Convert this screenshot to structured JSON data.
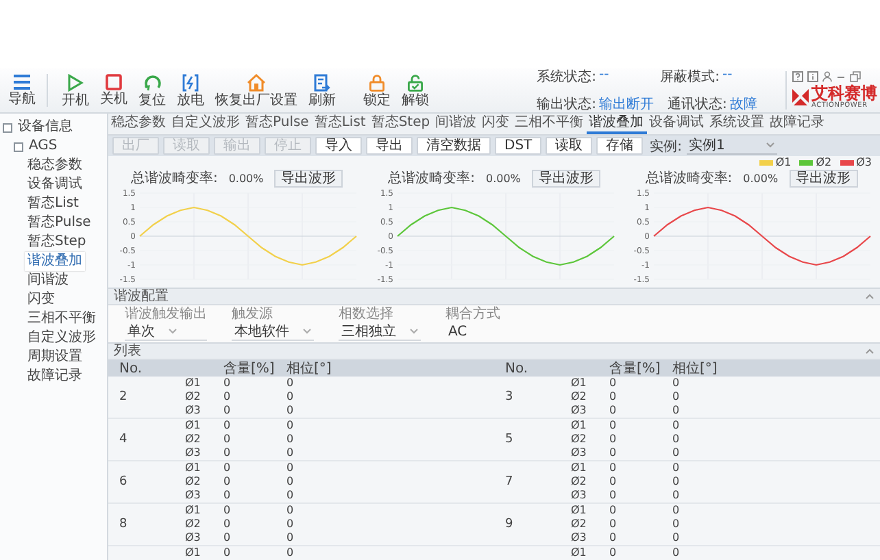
{
  "toolbar": [
    {
      "label": "导航"
    },
    {
      "label": "开机"
    },
    {
      "label": "关机"
    },
    {
      "label": "复位"
    },
    {
      "label": "放电"
    },
    {
      "label": "恢复出厂设置"
    },
    {
      "label": "刷新"
    },
    {
      "label": "锁定"
    },
    {
      "label": "解锁"
    }
  ],
  "status": {
    "rows": [
      [
        {
          "label": "系统状态:",
          "value": "--"
        },
        {
          "label": "屏蔽模式:",
          "value": "--"
        }
      ],
      [
        {
          "label": "输出状态:",
          "value": "输出断开"
        },
        {
          "label": "通讯状态:",
          "value": "故障"
        }
      ]
    ]
  },
  "logo": {
    "name": "艾科赛博",
    "sub": "ACTIONPOWER"
  },
  "sidebar": {
    "items": [
      {
        "label": "设备信息",
        "selected": false,
        "children": [
          {
            "label": "AGS",
            "selected": false,
            "children": [
              {
                "label": "稳态参数",
                "selected": false
              },
              {
                "label": "设备调试",
                "selected": false
              },
              {
                "label": "暂态List",
                "selected": false
              },
              {
                "label": "暂态Pulse",
                "selected": false
              },
              {
                "label": "暂态Step",
                "selected": false
              },
              {
                "label": "谐波叠加",
                "selected": true
              },
              {
                "label": "间谐波",
                "selected": false
              },
              {
                "label": "闪变",
                "selected": false
              },
              {
                "label": "三相不平衡",
                "selected": false
              },
              {
                "label": "自定义波形",
                "selected": false
              },
              {
                "label": "周期设置",
                "selected": false
              },
              {
                "label": "故障记录",
                "selected": false
              }
            ]
          }
        ]
      }
    ]
  },
  "tabs": [
    {
      "label": "稳态参数",
      "selected": false
    },
    {
      "label": "自定义波形",
      "selected": false
    },
    {
      "label": "暂态Pulse",
      "selected": false
    },
    {
      "label": "暂态List",
      "selected": false
    },
    {
      "label": "暂态Step",
      "selected": false
    },
    {
      "label": "间谐波",
      "selected": false
    },
    {
      "label": "闪变",
      "selected": false
    },
    {
      "label": "三相不平衡",
      "selected": false
    },
    {
      "label": "谐波叠加",
      "selected": true
    },
    {
      "label": "设备调试",
      "selected": false
    },
    {
      "label": "系统设置",
      "selected": false
    },
    {
      "label": "故障记录",
      "selected": false
    }
  ],
  "actions": [
    {
      "label": "出厂",
      "disabled": true
    },
    {
      "label": "读取",
      "disabled": true
    },
    {
      "label": "输出",
      "disabled": true
    },
    {
      "label": "停止",
      "disabled": true
    },
    {
      "label": "导入",
      "disabled": false
    },
    {
      "label": "导出",
      "disabled": false
    },
    {
      "label": "清空数据",
      "disabled": false
    },
    {
      "label": "DST",
      "disabled": false
    },
    {
      "label": "读取",
      "disabled": false
    },
    {
      "label": "存储",
      "disabled": false
    }
  ],
  "instance": {
    "label": "实例:",
    "value": "实例1"
  },
  "charts": [
    {
      "thd_label": "总谐波畸变率:",
      "thd_value": "0.00%",
      "export": "导出波形",
      "chart_data": {
        "type": "line",
        "grid": true,
        "ylim": [
          -1.5,
          1.5
        ],
        "yticks": [
          1.5,
          1,
          0.5,
          0,
          -0.5,
          -1,
          -1.5
        ],
        "series": [
          {
            "name": "Ø1",
            "color": "#f2d04a",
            "values": [
              0,
              0.4,
              0.7,
              0.9,
              1,
              0.9,
              0.7,
              0.4,
              0,
              -0.4,
              -0.7,
              -0.9,
              -1,
              -0.9,
              -0.7,
              -0.4,
              0
            ]
          }
        ]
      }
    },
    {
      "thd_label": "总谐波畸变率:",
      "thd_value": "0.00%",
      "export": "导出波形",
      "chart_data": {
        "type": "line",
        "grid": true,
        "ylim": [
          -1.5,
          1.5
        ],
        "yticks": [
          1.5,
          1,
          0.5,
          0,
          -0.5,
          -1,
          -1.5
        ],
        "series": [
          {
            "name": "Ø2",
            "color": "#5cc63a",
            "values": [
              0,
              0.4,
              0.7,
              0.9,
              1,
              0.9,
              0.7,
              0.4,
              0,
              -0.4,
              -0.7,
              -0.9,
              -1,
              -0.9,
              -0.7,
              -0.4,
              0
            ]
          }
        ]
      }
    },
    {
      "thd_label": "总谐波畸变率:",
      "thd_value": "0.00%",
      "export": "导出波形",
      "chart_data": {
        "type": "line",
        "grid": true,
        "ylim": [
          -1.5,
          1.5
        ],
        "yticks": [
          1.5,
          1,
          0.5,
          0,
          -0.5,
          -1,
          -1.5
        ],
        "series": [
          {
            "name": "Ø3",
            "color": "#e8474a",
            "values": [
              0,
              0.4,
              0.7,
              0.9,
              1,
              0.9,
              0.7,
              0.4,
              0,
              -0.4,
              -0.7,
              -0.9,
              -1,
              -0.9,
              -0.7,
              -0.4,
              0
            ]
          }
        ]
      }
    }
  ],
  "config": {
    "title": "谐波配置",
    "fields": [
      {
        "label": "谐波触发输出",
        "value": "单次",
        "kind": "select"
      },
      {
        "label": "触发源",
        "value": "本地软件",
        "kind": "select"
      },
      {
        "label": "相数选择",
        "value": "三相独立",
        "kind": "select"
      },
      {
        "label": "耦合方式",
        "value": "AC",
        "kind": "static"
      }
    ]
  },
  "list": {
    "title": "列表",
    "columns": [
      "No.",
      "含量[%]",
      "相位[°]",
      "No.",
      "含量[%]",
      "相位[°]"
    ],
    "rows": [
      {
        "left": {
          "no": "2",
          "phases": [
            {
              "phase": "Ø1",
              "content": "0",
              "angle": "0"
            },
            {
              "phase": "Ø2",
              "content": "0",
              "angle": "0"
            },
            {
              "phase": "Ø3",
              "content": "0",
              "angle": "0"
            }
          ]
        },
        "right": {
          "no": "3",
          "phases": [
            {
              "phase": "Ø1",
              "content": "0",
              "angle": "0"
            },
            {
              "phase": "Ø2",
              "content": "0",
              "angle": "0"
            },
            {
              "phase": "Ø3",
              "content": "0",
              "angle": "0"
            }
          ]
        }
      },
      {
        "left": {
          "no": "4",
          "phases": [
            {
              "phase": "Ø1",
              "content": "0",
              "angle": "0"
            },
            {
              "phase": "Ø2",
              "content": "0",
              "angle": "0"
            },
            {
              "phase": "Ø3",
              "content": "0",
              "angle": "0"
            }
          ]
        },
        "right": {
          "no": "5",
          "phases": [
            {
              "phase": "Ø1",
              "content": "0",
              "angle": "0"
            },
            {
              "phase": "Ø2",
              "content": "0",
              "angle": "0"
            },
            {
              "phase": "Ø3",
              "content": "0",
              "angle": "0"
            }
          ]
        }
      },
      {
        "left": {
          "no": "6",
          "phases": [
            {
              "phase": "Ø1",
              "content": "0",
              "angle": "0"
            },
            {
              "phase": "Ø2",
              "content": "0",
              "angle": "0"
            },
            {
              "phase": "Ø3",
              "content": "0",
              "angle": "0"
            }
          ]
        },
        "right": {
          "no": "7",
          "phases": [
            {
              "phase": "Ø1",
              "content": "0",
              "angle": "0"
            },
            {
              "phase": "Ø2",
              "content": "0",
              "angle": "0"
            },
            {
              "phase": "Ø3",
              "content": "0",
              "angle": "0"
            }
          ]
        }
      },
      {
        "left": {
          "no": "8",
          "phases": [
            {
              "phase": "Ø1",
              "content": "0",
              "angle": "0"
            },
            {
              "phase": "Ø2",
              "content": "0",
              "angle": "0"
            },
            {
              "phase": "Ø3",
              "content": "0",
              "angle": "0"
            }
          ]
        },
        "right": {
          "no": "9",
          "phases": [
            {
              "phase": "Ø1",
              "content": "0",
              "angle": "0"
            },
            {
              "phase": "Ø2",
              "content": "0",
              "angle": "0"
            },
            {
              "phase": "Ø3",
              "content": "0",
              "angle": "0"
            }
          ]
        }
      },
      {
        "left": {
          "phases": [
            {
              "phase": "Ø1",
              "content": "0",
              "angle": "0"
            }
          ]
        },
        "right": {
          "phases": [
            {
              "phase": "Ø1",
              "content": "0",
              "angle": "0"
            }
          ]
        }
      }
    ]
  }
}
